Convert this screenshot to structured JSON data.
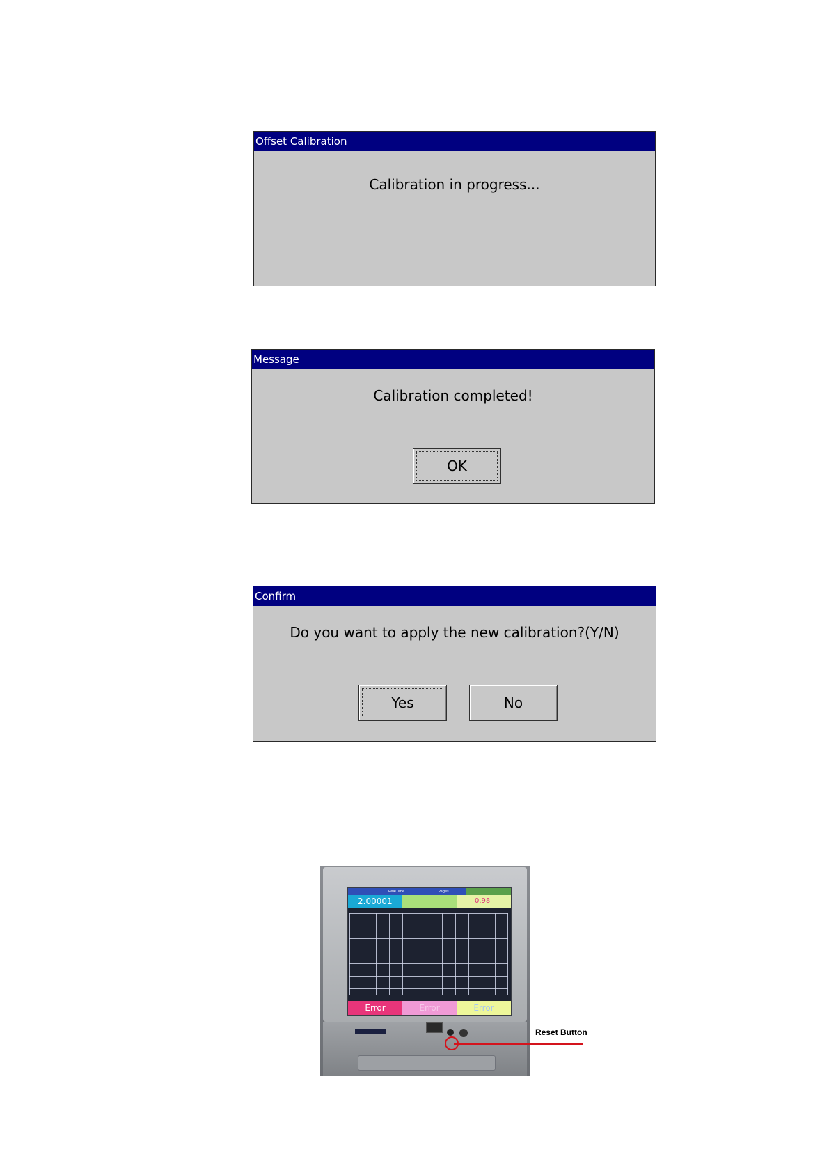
{
  "dialogs": {
    "offset_calibration": {
      "title": "Offset Calibration",
      "message": "Calibration in progress..."
    },
    "message": {
      "title": "Message",
      "message": "Calibration completed!",
      "ok_label": "OK"
    },
    "confirm": {
      "title": "Confirm",
      "message": "Do you want to apply the new calibration?(Y/N)",
      "yes_label": "Yes",
      "no_label": "No"
    }
  },
  "device_photo": {
    "screen_value": "2.00001",
    "screen_value_2": "0.98",
    "status_left": "Error",
    "status_mid": "Error",
    "status_right": "Error",
    "header_labels": [
      "RealTime",
      "Pages"
    ]
  },
  "callout": {
    "label": "Reset Button",
    "color": "#d4141d"
  },
  "colors": {
    "titlebar": "#000080",
    "dialog_bg": "#c8c8c8"
  }
}
